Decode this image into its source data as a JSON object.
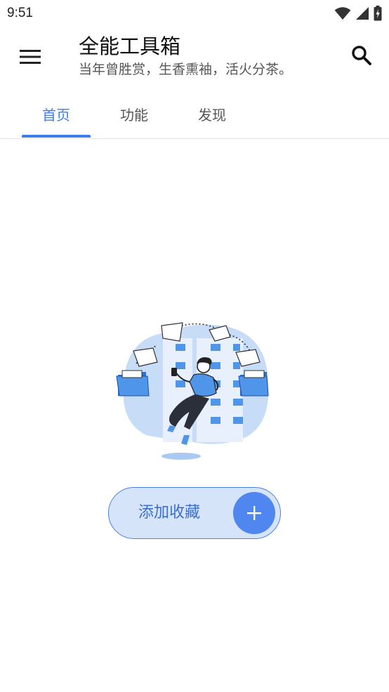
{
  "status_bar": {
    "time": "9:51",
    "icons": [
      "wifi-icon",
      "cellular-signal-icon",
      "battery-charging-icon"
    ]
  },
  "app_bar": {
    "title": "全能工具箱",
    "subtitle": "当年曾胜赏，生香熏袖，活火分茶。",
    "menu_icon": "hamburger-menu-icon",
    "search_icon": "search-icon"
  },
  "tabs": [
    {
      "label": "首页",
      "active": true
    },
    {
      "label": "功能",
      "active": false
    },
    {
      "label": "发现",
      "active": false
    }
  ],
  "empty_state": {
    "illustration": "person-floating-with-folders-illustration",
    "button_label": "添加收藏",
    "button_icon": "plus-icon"
  },
  "colors": {
    "accent": "#3d7ee8",
    "button_fill": "#d6e4fa",
    "button_circle": "#4f86ef",
    "illustration_light": "#c7dcf7",
    "illustration_mid": "#4f95ea"
  }
}
